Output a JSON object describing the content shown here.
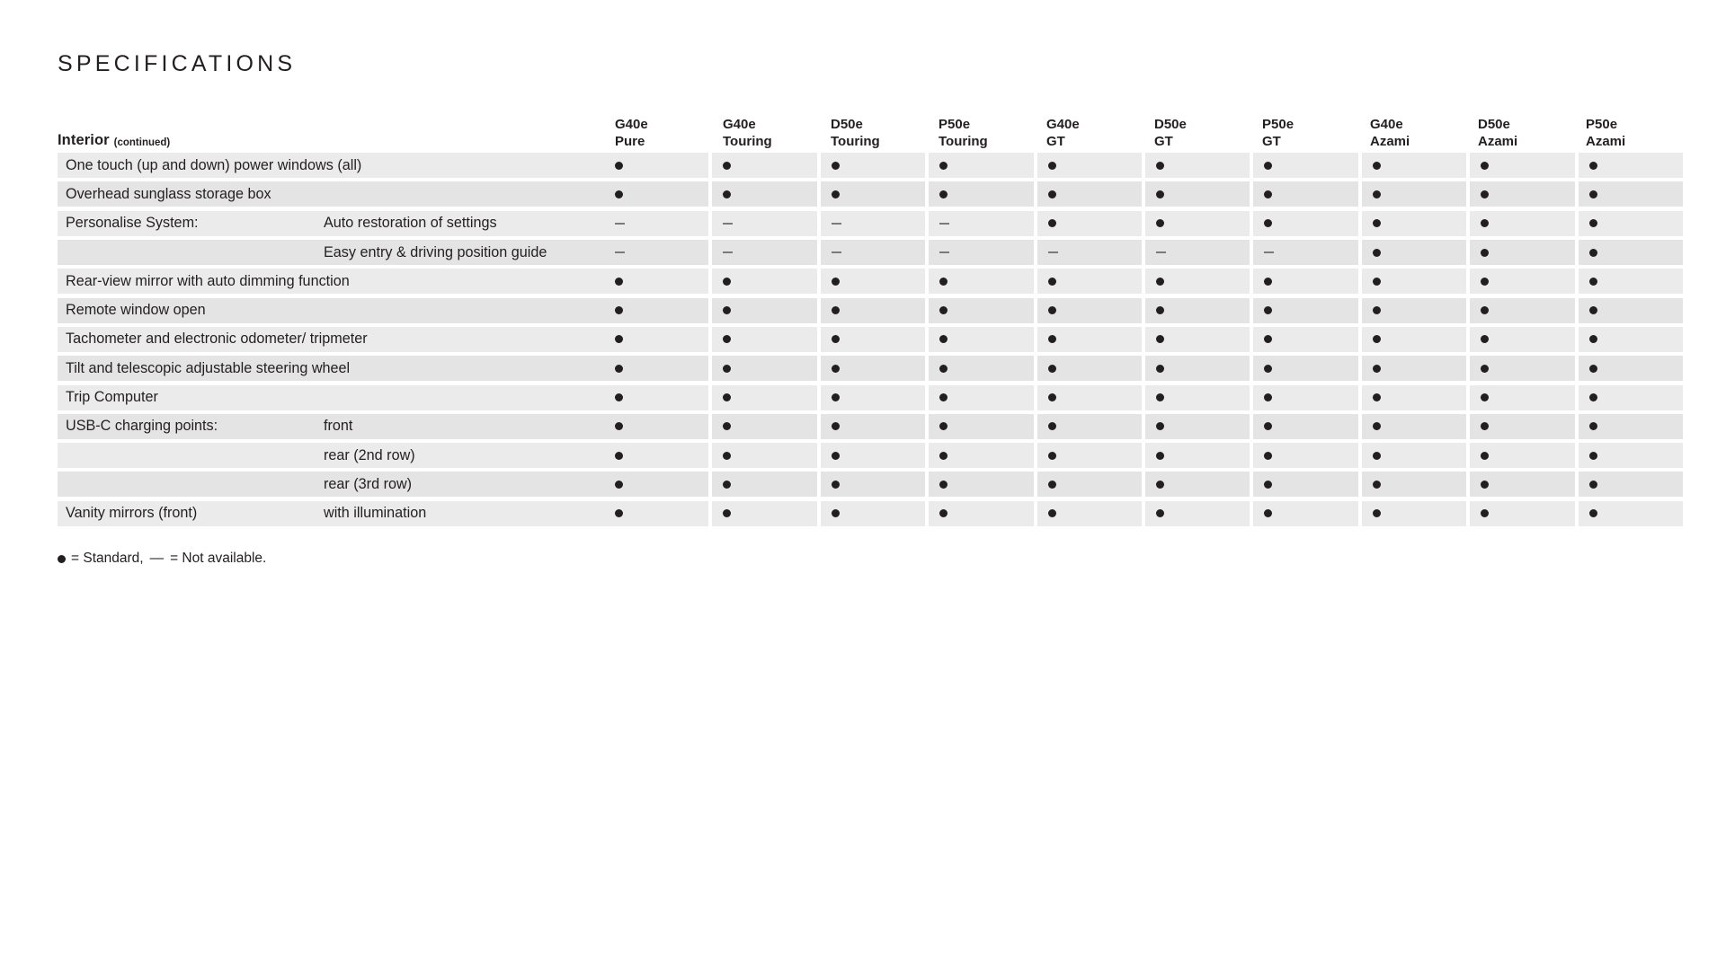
{
  "page": {
    "title": "SPECIFICATIONS",
    "background_color": "#ffffff",
    "text_color": "#231f20"
  },
  "table": {
    "section": {
      "name": "Interior",
      "continued": "(continued)"
    },
    "columns": [
      {
        "model": "G40e",
        "trim": "Pure"
      },
      {
        "model": "G40e",
        "trim": "Touring"
      },
      {
        "model": "D50e",
        "trim": "Touring"
      },
      {
        "model": "P50e",
        "trim": "Touring"
      },
      {
        "model": "G40e",
        "trim": "GT"
      },
      {
        "model": "D50e",
        "trim": "GT"
      },
      {
        "model": "P50e",
        "trim": "GT"
      },
      {
        "model": "G40e",
        "trim": "Azami"
      },
      {
        "model": "D50e",
        "trim": "Azami"
      },
      {
        "model": "P50e",
        "trim": "Azami"
      }
    ],
    "rows": [
      {
        "label": "One touch (up and down) power windows (all)",
        "sub": "",
        "values": [
          "dot",
          "dot",
          "dot",
          "dot",
          "dot",
          "dot",
          "dot",
          "dot",
          "dot",
          "dot"
        ]
      },
      {
        "label": "Overhead sunglass storage box",
        "sub": "",
        "values": [
          "dot",
          "dot",
          "dot",
          "dot",
          "dot",
          "dot",
          "dot",
          "dot",
          "dot",
          "dot"
        ]
      },
      {
        "label": "Personalise System:",
        "sub": "Auto restoration of settings",
        "values": [
          "dash",
          "dash",
          "dash",
          "dash",
          "dot",
          "dot",
          "dot",
          "dot",
          "dot",
          "dot"
        ]
      },
      {
        "label": "",
        "sub": "Easy entry & driving position guide",
        "values": [
          "dash",
          "dash",
          "dash",
          "dash",
          "dash",
          "dash",
          "dash",
          "dot",
          "dot",
          "dot"
        ]
      },
      {
        "label": "Rear-view mirror with auto dimming function",
        "sub": "",
        "values": [
          "dot",
          "dot",
          "dot",
          "dot",
          "dot",
          "dot",
          "dot",
          "dot",
          "dot",
          "dot"
        ]
      },
      {
        "label": "Remote window open",
        "sub": "",
        "values": [
          "dot",
          "dot",
          "dot",
          "dot",
          "dot",
          "dot",
          "dot",
          "dot",
          "dot",
          "dot"
        ]
      },
      {
        "label": "Tachometer and electronic odometer/ tripmeter",
        "sub": "",
        "values": [
          "dot",
          "dot",
          "dot",
          "dot",
          "dot",
          "dot",
          "dot",
          "dot",
          "dot",
          "dot"
        ]
      },
      {
        "label": "Tilt and telescopic adjustable steering wheel",
        "sub": "",
        "values": [
          "dot",
          "dot",
          "dot",
          "dot",
          "dot",
          "dot",
          "dot",
          "dot",
          "dot",
          "dot"
        ]
      },
      {
        "label": "Trip Computer",
        "sub": "",
        "values": [
          "dot",
          "dot",
          "dot",
          "dot",
          "dot",
          "dot",
          "dot",
          "dot",
          "dot",
          "dot"
        ]
      },
      {
        "label": "USB-C charging points:",
        "sub": "front",
        "values": [
          "dot",
          "dot",
          "dot",
          "dot",
          "dot",
          "dot",
          "dot",
          "dot",
          "dot",
          "dot"
        ]
      },
      {
        "label": "",
        "sub": "rear (2nd row)",
        "values": [
          "dot",
          "dot",
          "dot",
          "dot",
          "dot",
          "dot",
          "dot",
          "dot",
          "dot",
          "dot"
        ]
      },
      {
        "label": "",
        "sub": "rear (3rd row)",
        "values": [
          "dot",
          "dot",
          "dot",
          "dot",
          "dot",
          "dot",
          "dot",
          "dot",
          "dot",
          "dot"
        ]
      },
      {
        "label": "Vanity mirrors (front)",
        "sub": "with illumination",
        "values": [
          "dot",
          "dot",
          "dot",
          "dot",
          "dot",
          "dot",
          "dot",
          "dot",
          "dot",
          "dot"
        ]
      }
    ]
  },
  "legend": {
    "standard_text": "= Standard,",
    "not_available_dash": "—",
    "not_available_text": "= Not available."
  }
}
